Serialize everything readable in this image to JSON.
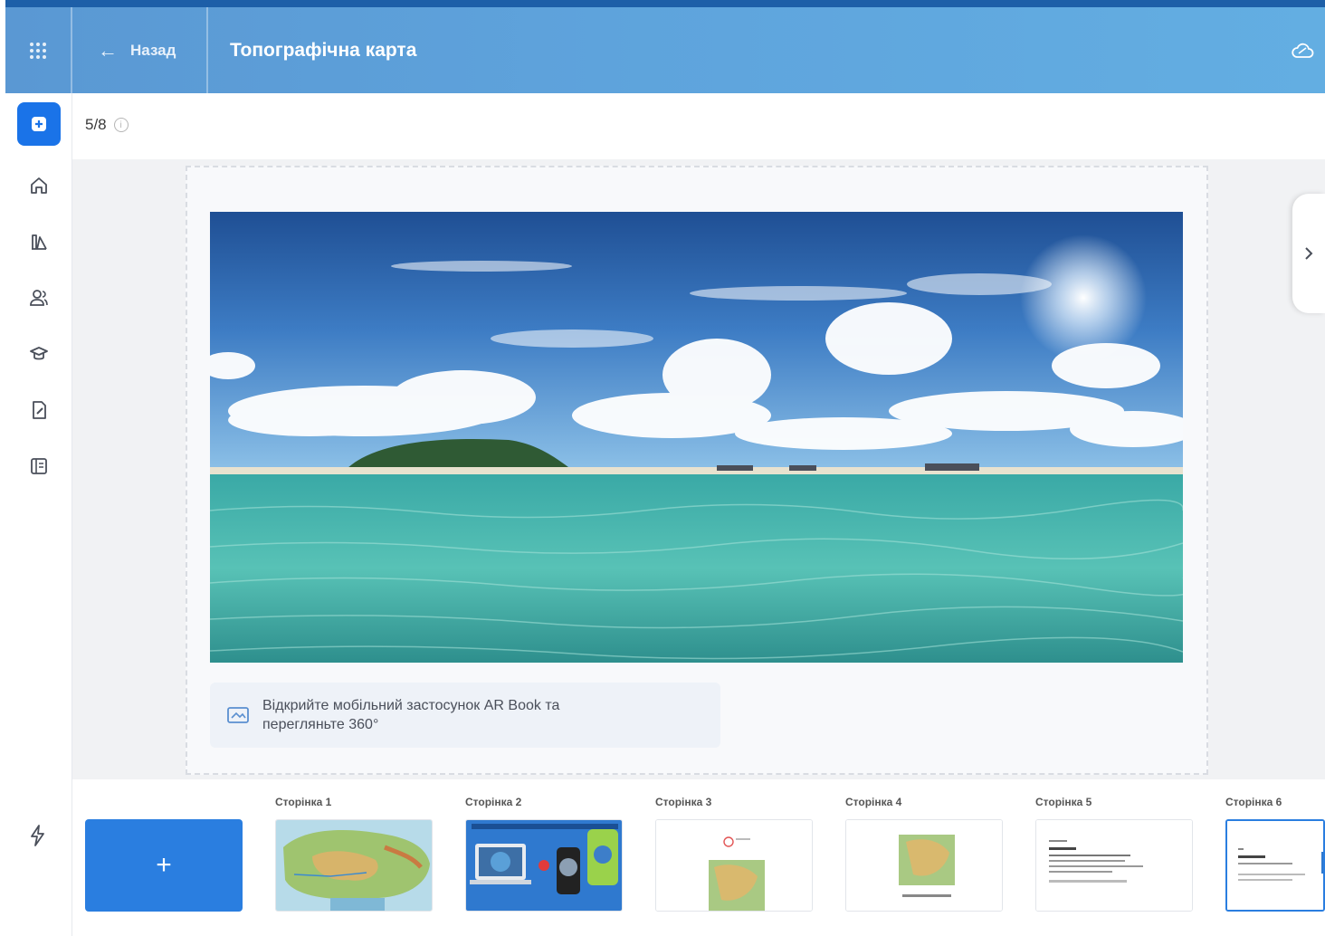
{
  "header": {
    "back_label": "Назад",
    "title": "Топографічна карта"
  },
  "sidebar": {
    "items": [
      {
        "icon": "plus-square-icon"
      },
      {
        "icon": "home-icon"
      },
      {
        "icon": "library-icon"
      },
      {
        "icon": "users-icon"
      },
      {
        "icon": "graduation-cap-icon"
      },
      {
        "icon": "edit-document-icon"
      },
      {
        "icon": "book-icon"
      }
    ],
    "bottom_icon": "lightning-icon"
  },
  "counter": {
    "text": "5/8"
  },
  "slide": {
    "note_text": "Відкрийте мобільний застосунок AR Book та перегляньте 360°"
  },
  "pages": {
    "add_label": "+",
    "items": [
      {
        "label": "Сторінка 1"
      },
      {
        "label": "Сторінка 2"
      },
      {
        "label": "Сторінка 3"
      },
      {
        "label": "Сторінка 4"
      },
      {
        "label": "Сторінка 5"
      },
      {
        "label": "Сторінка 6"
      }
    ]
  },
  "colors": {
    "accent": "#1a73e8",
    "header": "#5ea3dc",
    "add_button": "#2a7ee0"
  }
}
